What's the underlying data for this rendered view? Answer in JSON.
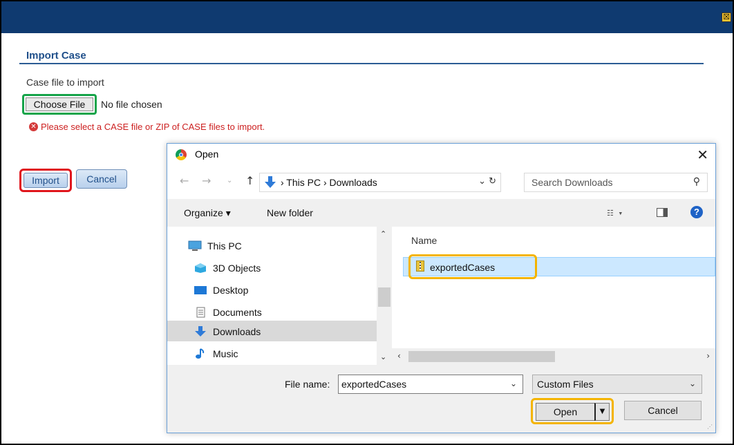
{
  "page": {
    "title": "Import Case",
    "case_label": "Case file to import",
    "choose_file": "Choose File",
    "no_file": "No file chosen",
    "error": "Please select a CASE file or ZIP of CASE files to import.",
    "import_label": "Import",
    "cancel_label": "Cancel",
    "close_glyph": "☒"
  },
  "dialog": {
    "title": "Open",
    "close_glyph": "✕",
    "breadcrumb": "› This PC › Downloads",
    "search_placeholder": "Search Downloads",
    "organize": "Organize ▾",
    "new_folder": "New folder",
    "tree": [
      {
        "label": "This PC",
        "icon": "pc-icon"
      },
      {
        "label": "3D Objects",
        "icon": "cube-icon"
      },
      {
        "label": "Desktop",
        "icon": "desktop-icon"
      },
      {
        "label": "Documents",
        "icon": "document-icon"
      },
      {
        "label": "Downloads",
        "icon": "download-icon"
      },
      {
        "label": "Music",
        "icon": "music-icon"
      }
    ],
    "selected_tree": "Downloads",
    "column_name": "Name",
    "files": [
      {
        "name": "exportedCases",
        "icon": "zip-folder-icon"
      }
    ],
    "file_name_label": "File name:",
    "file_name_value": "exportedCases",
    "file_type": "Custom Files",
    "open_label": "Open",
    "cancel_label": "Cancel"
  },
  "colors": {
    "topbar": "#0f3a70",
    "title": "#1f4f8a",
    "error": "#cc1f1f",
    "highlight_green": "#16a44a",
    "highlight_red": "#e0151c",
    "highlight_orange": "#f4b400"
  }
}
